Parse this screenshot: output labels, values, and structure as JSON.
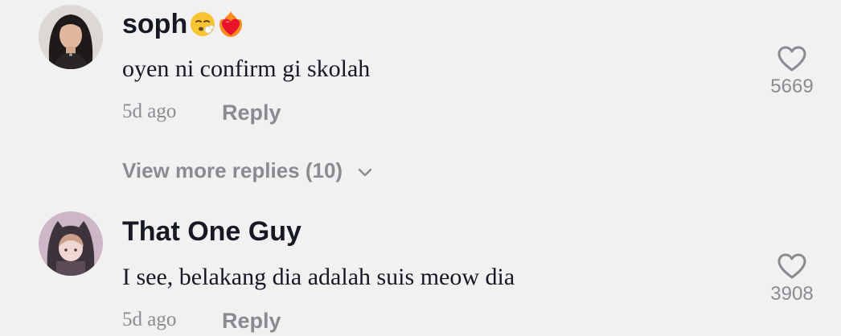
{
  "comments": [
    {
      "username": "soph",
      "badges": [
        "tired-face-emoji",
        "heart-on-fire-emoji"
      ],
      "text": "oyen ni confirm gi skolah",
      "time": "5d ago",
      "reply_label": "Reply",
      "likes": "5669"
    },
    {
      "username": "That One Guy",
      "text": "I see, belakang dia adalah suis meow dia",
      "time": "5d ago",
      "reply_label": "Reply",
      "likes": "3908"
    }
  ],
  "view_more": {
    "label": "View more replies (10)",
    "icon": "chevron-down-icon"
  },
  "colors": {
    "background": "#f1f1f2",
    "primary_text": "#161823",
    "secondary_text": "#8a8b91"
  }
}
